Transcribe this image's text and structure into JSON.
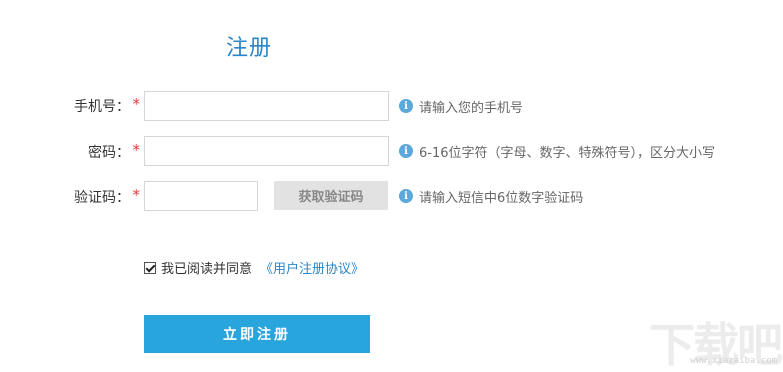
{
  "form": {
    "title": "注册",
    "required_mark": "*",
    "phone": {
      "label": "手机号：",
      "value": "",
      "hint": "请输入您的手机号"
    },
    "password": {
      "label": "密码：",
      "value": "",
      "hint": "6-16位字符（字母、数字、特殊符号），区分大小写"
    },
    "captcha": {
      "label": "验证码：",
      "value": "",
      "button_label": "获取验证码",
      "hint": "请输入短信中6位数字验证码"
    },
    "agreement": {
      "checked": true,
      "text": "我已阅读并同意",
      "link_text": "《用户注册协议》"
    },
    "submit_label": "立即注册"
  },
  "info_icon_glyph": "i",
  "watermark": {
    "text": "下载吧",
    "sub": "www.xiazaiba.com"
  },
  "colors": {
    "title": "#2a86c9",
    "required": "#e4393c",
    "link": "#2a86c9",
    "submit_bg": "#29a5de",
    "info_icon": "#5aa8dc"
  }
}
